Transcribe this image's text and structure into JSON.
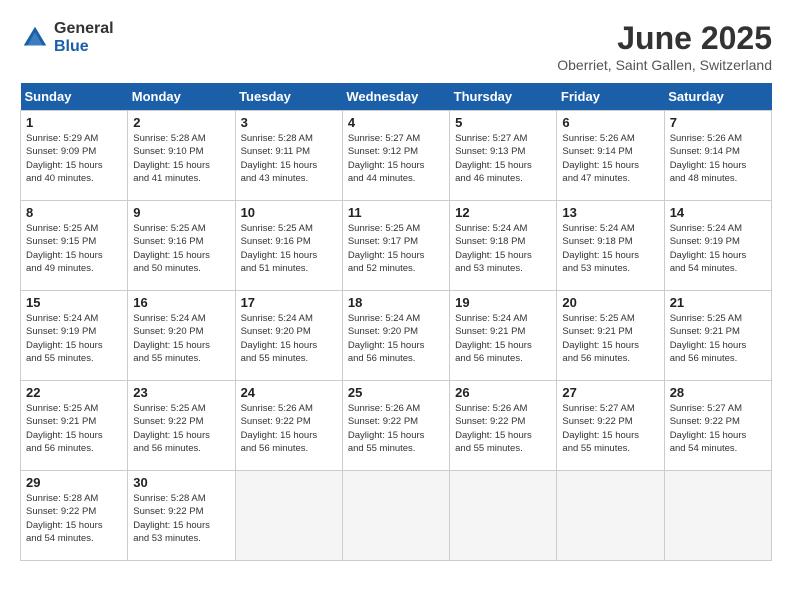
{
  "logo": {
    "general": "General",
    "blue": "Blue"
  },
  "title": "June 2025",
  "subtitle": "Oberriet, Saint Gallen, Switzerland",
  "days_header": [
    "Sunday",
    "Monday",
    "Tuesday",
    "Wednesday",
    "Thursday",
    "Friday",
    "Saturday"
  ],
  "weeks": [
    [
      {
        "day": 1,
        "info": "Sunrise: 5:29 AM\nSunset: 9:09 PM\nDaylight: 15 hours\nand 40 minutes."
      },
      {
        "day": 2,
        "info": "Sunrise: 5:28 AM\nSunset: 9:10 PM\nDaylight: 15 hours\nand 41 minutes."
      },
      {
        "day": 3,
        "info": "Sunrise: 5:28 AM\nSunset: 9:11 PM\nDaylight: 15 hours\nand 43 minutes."
      },
      {
        "day": 4,
        "info": "Sunrise: 5:27 AM\nSunset: 9:12 PM\nDaylight: 15 hours\nand 44 minutes."
      },
      {
        "day": 5,
        "info": "Sunrise: 5:27 AM\nSunset: 9:13 PM\nDaylight: 15 hours\nand 46 minutes."
      },
      {
        "day": 6,
        "info": "Sunrise: 5:26 AM\nSunset: 9:14 PM\nDaylight: 15 hours\nand 47 minutes."
      },
      {
        "day": 7,
        "info": "Sunrise: 5:26 AM\nSunset: 9:14 PM\nDaylight: 15 hours\nand 48 minutes."
      }
    ],
    [
      {
        "day": 8,
        "info": "Sunrise: 5:25 AM\nSunset: 9:15 PM\nDaylight: 15 hours\nand 49 minutes."
      },
      {
        "day": 9,
        "info": "Sunrise: 5:25 AM\nSunset: 9:16 PM\nDaylight: 15 hours\nand 50 minutes."
      },
      {
        "day": 10,
        "info": "Sunrise: 5:25 AM\nSunset: 9:16 PM\nDaylight: 15 hours\nand 51 minutes."
      },
      {
        "day": 11,
        "info": "Sunrise: 5:25 AM\nSunset: 9:17 PM\nDaylight: 15 hours\nand 52 minutes."
      },
      {
        "day": 12,
        "info": "Sunrise: 5:24 AM\nSunset: 9:18 PM\nDaylight: 15 hours\nand 53 minutes."
      },
      {
        "day": 13,
        "info": "Sunrise: 5:24 AM\nSunset: 9:18 PM\nDaylight: 15 hours\nand 53 minutes."
      },
      {
        "day": 14,
        "info": "Sunrise: 5:24 AM\nSunset: 9:19 PM\nDaylight: 15 hours\nand 54 minutes."
      }
    ],
    [
      {
        "day": 15,
        "info": "Sunrise: 5:24 AM\nSunset: 9:19 PM\nDaylight: 15 hours\nand 55 minutes."
      },
      {
        "day": 16,
        "info": "Sunrise: 5:24 AM\nSunset: 9:20 PM\nDaylight: 15 hours\nand 55 minutes."
      },
      {
        "day": 17,
        "info": "Sunrise: 5:24 AM\nSunset: 9:20 PM\nDaylight: 15 hours\nand 55 minutes."
      },
      {
        "day": 18,
        "info": "Sunrise: 5:24 AM\nSunset: 9:20 PM\nDaylight: 15 hours\nand 56 minutes."
      },
      {
        "day": 19,
        "info": "Sunrise: 5:24 AM\nSunset: 9:21 PM\nDaylight: 15 hours\nand 56 minutes."
      },
      {
        "day": 20,
        "info": "Sunrise: 5:25 AM\nSunset: 9:21 PM\nDaylight: 15 hours\nand 56 minutes."
      },
      {
        "day": 21,
        "info": "Sunrise: 5:25 AM\nSunset: 9:21 PM\nDaylight: 15 hours\nand 56 minutes."
      }
    ],
    [
      {
        "day": 22,
        "info": "Sunrise: 5:25 AM\nSunset: 9:21 PM\nDaylight: 15 hours\nand 56 minutes."
      },
      {
        "day": 23,
        "info": "Sunrise: 5:25 AM\nSunset: 9:22 PM\nDaylight: 15 hours\nand 56 minutes."
      },
      {
        "day": 24,
        "info": "Sunrise: 5:26 AM\nSunset: 9:22 PM\nDaylight: 15 hours\nand 56 minutes."
      },
      {
        "day": 25,
        "info": "Sunrise: 5:26 AM\nSunset: 9:22 PM\nDaylight: 15 hours\nand 55 minutes."
      },
      {
        "day": 26,
        "info": "Sunrise: 5:26 AM\nSunset: 9:22 PM\nDaylight: 15 hours\nand 55 minutes."
      },
      {
        "day": 27,
        "info": "Sunrise: 5:27 AM\nSunset: 9:22 PM\nDaylight: 15 hours\nand 55 minutes."
      },
      {
        "day": 28,
        "info": "Sunrise: 5:27 AM\nSunset: 9:22 PM\nDaylight: 15 hours\nand 54 minutes."
      }
    ],
    [
      {
        "day": 29,
        "info": "Sunrise: 5:28 AM\nSunset: 9:22 PM\nDaylight: 15 hours\nand 54 minutes."
      },
      {
        "day": 30,
        "info": "Sunrise: 5:28 AM\nSunset: 9:22 PM\nDaylight: 15 hours\nand 53 minutes."
      },
      null,
      null,
      null,
      null,
      null
    ]
  ]
}
